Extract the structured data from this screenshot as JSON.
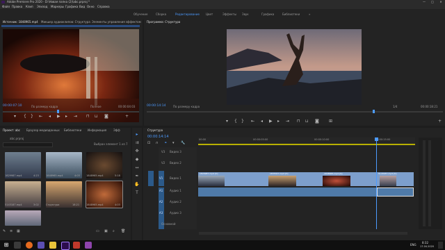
{
  "app": {
    "title": "Adobe Premiere Pro 2020 - D:\\Новая папка (2)\\abc.prproj *",
    "win_minimize": "—",
    "win_maximize": "□",
    "win_close": "✕"
  },
  "menu": [
    "Файл",
    "Правка",
    "Клип",
    "Эпизод",
    "Маркеры",
    "Графика",
    "Вид",
    "Окно",
    "Справка"
  ],
  "workspaces": {
    "items": [
      "Обучение",
      "Сборка",
      "Редактирование",
      "Цвет",
      "Эффекты",
      "Звук",
      "Графика",
      "Библиотеки"
    ],
    "active": "Редактирование",
    "more": "»"
  },
  "source": {
    "tabs": [
      "Источник: 1848965.mp4",
      "Микшер аудиоклипов: Структура",
      "Элементы управления эффектом"
    ],
    "timecode": "00:00:07:10",
    "fit": "По размеру кадра",
    "resolution": "Полное",
    "duration": "00:00:04:03"
  },
  "program": {
    "tab": "Программа: Структура",
    "timecode": "00:00:14:14",
    "fit": "По размеру кадра",
    "resolution": "1/4",
    "duration": "00:00:18:21"
  },
  "project": {
    "tabs": [
      "Проект: abc",
      "Браузер медиаданных",
      "Библиотеки",
      "Информация",
      "Эфф"
    ],
    "project_file": "abc.prproj",
    "selection": "Выбран элемент 1 из 7",
    "items": [
      {
        "name": "1829987.mp4",
        "duration": "4:23"
      },
      {
        "name": "1848965.mp4",
        "duration": "4:03"
      },
      {
        "name": "1848965.mp4",
        "duration": "5:18"
      },
      {
        "name": "5143187.mp4",
        "duration": "3:02"
      },
      {
        "name": "Структура",
        "duration": "18:21"
      },
      {
        "name": "1848965.mp4",
        "duration": "4:03"
      },
      {
        "name": "5143187.mp4",
        "duration": ""
      }
    ]
  },
  "timeline": {
    "tab": "Структура",
    "timecode": "00:00:14:14",
    "ruler": [
      "00:00",
      "00:00:05:00",
      "00:00:10:00",
      "00:00:15:00"
    ],
    "video_tracks": [
      "V3",
      "V2",
      "V1"
    ],
    "audio_tracks": [
      "A1",
      "A2",
      "A3"
    ],
    "track_names": {
      "V3": "Видео 3",
      "V2": "Видео 2",
      "V1": "Видео 1",
      "A1": "Аудио 1",
      "A2": "Аудио 2",
      "A3": "Аудио 3"
    },
    "clips": [
      "1829987.mp4 [V]",
      "1835347.mp4 [V]",
      "1848965.mp4 [V]",
      "5143187.mp4 [V]"
    ],
    "master": "Основной"
  },
  "taskbar": {
    "lang": "ENG",
    "time": "8:32",
    "date": "17.04.2020"
  },
  "colors": {
    "accent": "#4d9bff",
    "clip_video": "#7d9fcc",
    "clip_audio": "#4f7aa8",
    "premiere": "#2c0d4d"
  }
}
